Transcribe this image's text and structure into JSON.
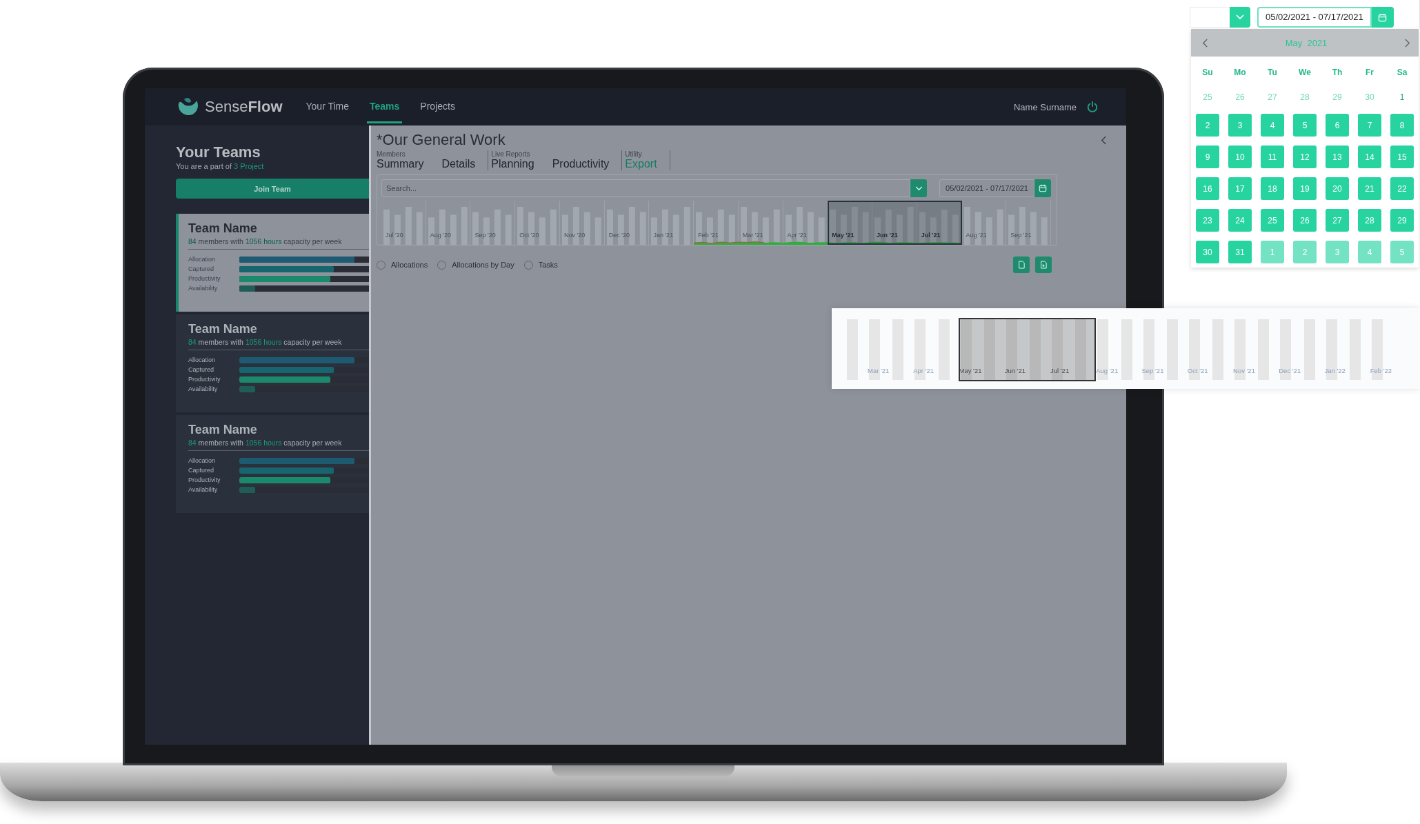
{
  "nav": {
    "brand_light": "Sense",
    "brand_bold": "Flow",
    "items": [
      {
        "label": "Your Time",
        "selected": false
      },
      {
        "label": "Teams",
        "selected": true
      },
      {
        "label": "Projects",
        "selected": false
      }
    ],
    "user": "Name Surname"
  },
  "sidebar": {
    "title": "Your Teams",
    "subtitle": "You are a part of",
    "subtitle_link": "3 Project",
    "join_button": "Join Team",
    "teams": [
      {
        "name": "Team Name",
        "members": "84",
        "members_text": "members with",
        "hours": "1056 hours",
        "hours_text": "capacity per week",
        "selected": true,
        "metrics": [
          {
            "label": "Allocation",
            "level": 0.89,
            "color": "#1f5a73"
          },
          {
            "label": "Captured",
            "level": 0.73,
            "color": "#17656e"
          },
          {
            "label": "Productivity",
            "level": 0.7,
            "color": "#1b8a6c"
          },
          {
            "label": "Availability",
            "level": 0.12,
            "color": "#1f5e57"
          }
        ]
      },
      {
        "name": "Team Name",
        "members": "84",
        "members_text": "members with",
        "hours": "1056 hours",
        "hours_text": "capacity per week",
        "selected": false,
        "metrics": [
          {
            "label": "Allocation",
            "level": 0.89,
            "color": "#1f5a73"
          },
          {
            "label": "Captured",
            "level": 0.73,
            "color": "#17656e"
          },
          {
            "label": "Productivity",
            "level": 0.7,
            "color": "#1b8a6c"
          },
          {
            "label": "Availability",
            "level": 0.12,
            "color": "#1f5e57"
          }
        ]
      },
      {
        "name": "Team Name",
        "members": "84",
        "members_text": "members with",
        "hours": "1056 hours",
        "hours_text": "capacity per week",
        "selected": false,
        "metrics": [
          {
            "label": "Allocation",
            "level": 0.89,
            "color": "#1f5a73"
          },
          {
            "label": "Captured",
            "level": 0.73,
            "color": "#17656e"
          },
          {
            "label": "Productivity",
            "level": 0.7,
            "color": "#1b8a6c"
          },
          {
            "label": "Availability",
            "level": 0.12,
            "color": "#1f5e57"
          }
        ]
      }
    ]
  },
  "main": {
    "title": "*Our General Work",
    "tab_groups": [
      {
        "label": "Members",
        "tabs": [
          {
            "label": "Summary",
            "selected": false
          },
          {
            "label": "Details",
            "selected": false
          }
        ]
      },
      {
        "label": "Live Reports",
        "tabs": [
          {
            "label": "Planning",
            "selected": false
          },
          {
            "label": "Productivity",
            "selected": false
          }
        ]
      },
      {
        "label": "Utility",
        "tabs": [
          {
            "label": "Export",
            "selected": true
          }
        ]
      }
    ],
    "search": {
      "placeholder": "Search..."
    },
    "date_range": "05/02/2021 - 07/17/2021",
    "timeline": {
      "months": [
        {
          "label": "Jul '20",
          "selected": false
        },
        {
          "label": "Aug '20",
          "selected": false
        },
        {
          "label": "Sep '20",
          "selected": false
        },
        {
          "label": "Oct '20",
          "selected": false
        },
        {
          "label": "Nov '20",
          "selected": false
        },
        {
          "label": "Dec '20",
          "selected": false
        },
        {
          "label": "Jan '21",
          "selected": false
        },
        {
          "label": "Feb '21",
          "selected": false
        },
        {
          "label": "Mar '21",
          "selected": false
        },
        {
          "label": "Apr '21",
          "selected": false
        },
        {
          "label": "May '21",
          "selected": true
        },
        {
          "label": "Jun '21",
          "selected": true
        },
        {
          "label": "Jul '21",
          "selected": true
        },
        {
          "label": "Aug '21",
          "selected": false
        },
        {
          "label": "Sep '21",
          "selected": false
        }
      ]
    },
    "radios": [
      {
        "label": "Allocations",
        "selected": false
      },
      {
        "label": "Allocations by Day",
        "selected": false
      },
      {
        "label": "Tasks",
        "selected": false
      }
    ]
  },
  "calendar_popup": {
    "date_range": "05/02/2021 - 07/17/2021",
    "month": "May  2021",
    "weekdays": [
      "Su",
      "Mo",
      "Tu",
      "We",
      "Th",
      "Fr",
      "Sa"
    ],
    "days": [
      {
        "label": "25",
        "kind": "prev",
        "in_range": false
      },
      {
        "label": "26",
        "kind": "prev",
        "in_range": false
      },
      {
        "label": "27",
        "kind": "prev",
        "in_range": false
      },
      {
        "label": "28",
        "kind": "prev",
        "in_range": false
      },
      {
        "label": "29",
        "kind": "prev",
        "in_range": false
      },
      {
        "label": "30",
        "kind": "prev",
        "in_range": false
      },
      {
        "label": "1",
        "kind": "current",
        "in_range": false
      },
      {
        "label": "2",
        "kind": "current",
        "in_range": true
      },
      {
        "label": "3",
        "kind": "current",
        "in_range": true
      },
      {
        "label": "4",
        "kind": "current",
        "in_range": true
      },
      {
        "label": "5",
        "kind": "current",
        "in_range": true
      },
      {
        "label": "6",
        "kind": "current",
        "in_range": true
      },
      {
        "label": "7",
        "kind": "current",
        "in_range": true
      },
      {
        "label": "8",
        "kind": "current",
        "in_range": true
      },
      {
        "label": "9",
        "kind": "current",
        "in_range": true
      },
      {
        "label": "10",
        "kind": "current",
        "in_range": true
      },
      {
        "label": "11",
        "kind": "current",
        "in_range": true
      },
      {
        "label": "12",
        "kind": "current",
        "in_range": true
      },
      {
        "label": "13",
        "kind": "current",
        "in_range": true
      },
      {
        "label": "14",
        "kind": "current",
        "in_range": true
      },
      {
        "label": "15",
        "kind": "current",
        "in_range": true
      },
      {
        "label": "16",
        "kind": "current",
        "in_range": true
      },
      {
        "label": "17",
        "kind": "current",
        "in_range": true
      },
      {
        "label": "18",
        "kind": "current",
        "in_range": true
      },
      {
        "label": "19",
        "kind": "current",
        "in_range": true
      },
      {
        "label": "20",
        "kind": "current",
        "in_range": true
      },
      {
        "label": "21",
        "kind": "current",
        "in_range": true
      },
      {
        "label": "22",
        "kind": "current",
        "in_range": true
      },
      {
        "label": "23",
        "kind": "current",
        "in_range": true
      },
      {
        "label": "24",
        "kind": "current",
        "in_range": true
      },
      {
        "label": "25",
        "kind": "current",
        "in_range": true
      },
      {
        "label": "26",
        "kind": "current",
        "in_range": true
      },
      {
        "label": "27",
        "kind": "current",
        "in_range": true
      },
      {
        "label": "28",
        "kind": "current",
        "in_range": true
      },
      {
        "label": "29",
        "kind": "current",
        "in_range": true
      },
      {
        "label": "30",
        "kind": "current",
        "in_range": true
      },
      {
        "label": "31",
        "kind": "current",
        "in_range": true
      },
      {
        "label": "1",
        "kind": "next",
        "in_range": true
      },
      {
        "label": "2",
        "kind": "next",
        "in_range": true
      },
      {
        "label": "3",
        "kind": "next",
        "in_range": true
      },
      {
        "label": "4",
        "kind": "next",
        "in_range": true
      },
      {
        "label": "5",
        "kind": "next",
        "in_range": true
      }
    ]
  },
  "timeline_zoom": {
    "months": [
      {
        "label": "Mar '21",
        "selected": false
      },
      {
        "label": "Apr '21",
        "selected": false
      },
      {
        "label": "May '21",
        "selected": true
      },
      {
        "label": "Jun '21",
        "selected": true
      },
      {
        "label": "Jul '21",
        "selected": true
      },
      {
        "label": "Aug '21",
        "selected": false
      },
      {
        "label": "Sep '21",
        "selected": false
      },
      {
        "label": "Oct '21",
        "selected": false
      },
      {
        "label": "Nov '21",
        "selected": false
      },
      {
        "label": "Dec '21",
        "selected": false
      },
      {
        "label": "Jan '22",
        "selected": false
      },
      {
        "label": "Feb '22",
        "selected": false
      }
    ]
  }
}
